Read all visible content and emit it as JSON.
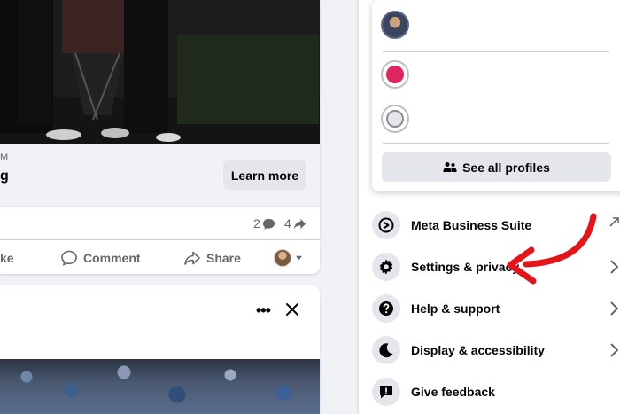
{
  "post": {
    "domain": "M",
    "title": "g",
    "learn_more": "Learn more",
    "comments_count": "2",
    "shares_count": "4",
    "actions": {
      "like": "ke",
      "comment": "Comment",
      "share": "Share"
    }
  },
  "profiles": {
    "see_all_label": "See all profiles"
  },
  "menu": {
    "items": [
      {
        "label": "Meta Business Suite",
        "icon": "meta-business-suite-icon",
        "trailing": "external-link-icon"
      },
      {
        "label": "Settings & privacy",
        "icon": "gear-icon",
        "trailing": "chevron-right-icon"
      },
      {
        "label": "Help & support",
        "icon": "question-icon",
        "trailing": "chevron-right-icon"
      },
      {
        "label": "Display & accessibility",
        "icon": "moon-icon",
        "trailing": "chevron-right-icon"
      },
      {
        "label": "Give feedback",
        "icon": "feedback-icon",
        "trailing": ""
      }
    ]
  },
  "colors": {
    "annotation_arrow": "#e4141b",
    "background": "#f0f2f5",
    "button_gray": "#e4e6eb"
  }
}
